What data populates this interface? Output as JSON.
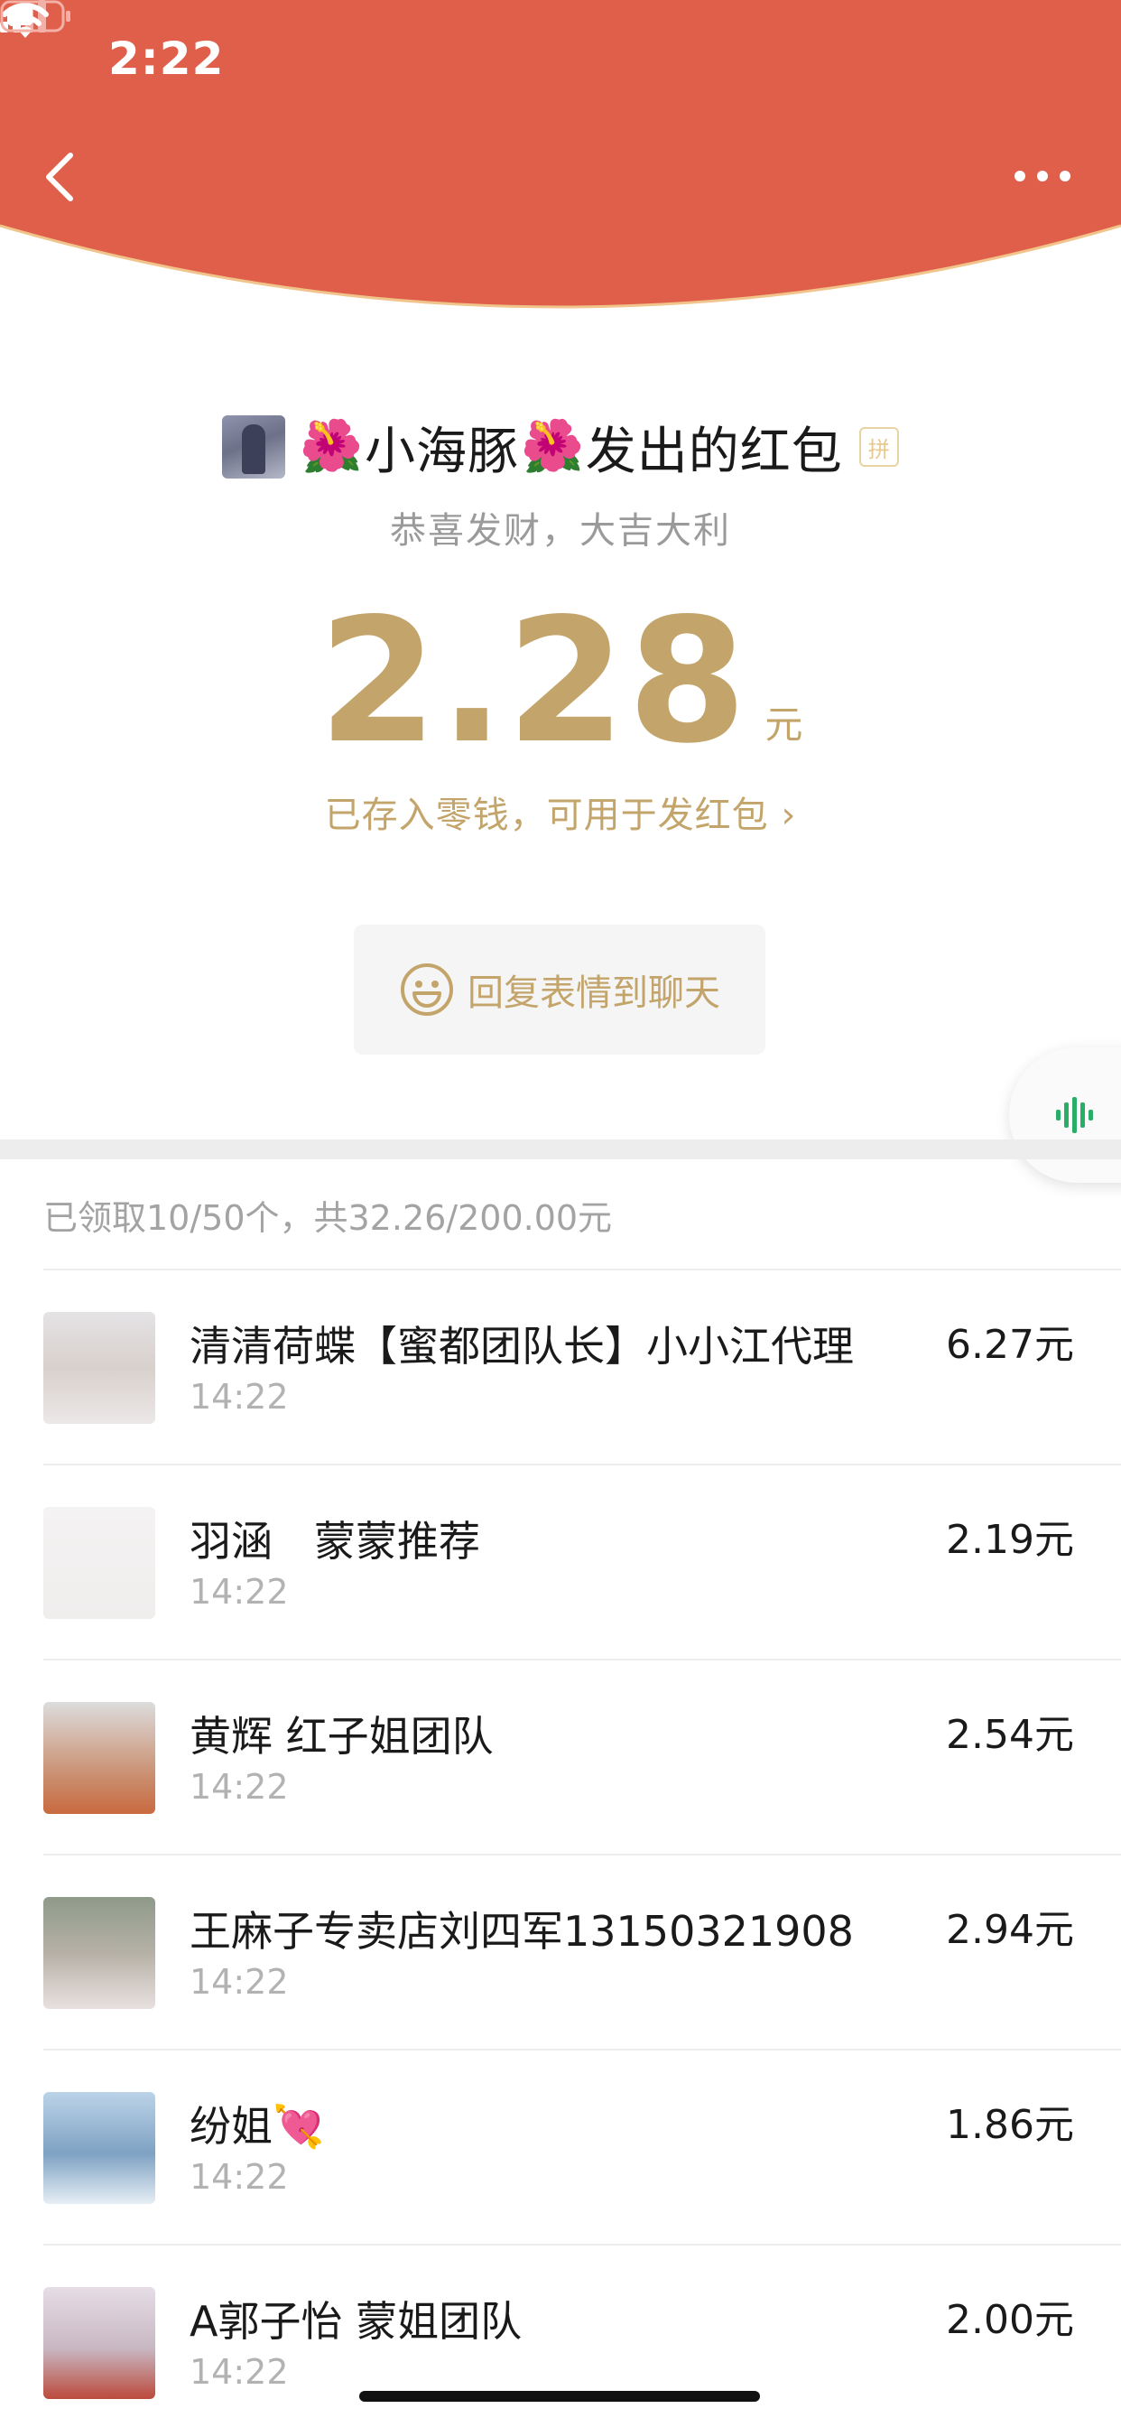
{
  "status_bar": {
    "time": "2:22"
  },
  "header": {
    "color": "#e05f4b",
    "icons": [
      "back-arrow-icon",
      "more-dots-icon"
    ]
  },
  "packet": {
    "sender_title": "小海豚",
    "sender_suffix": "发出的红包",
    "flower_emoji": "🌺",
    "pin_badge": "拼",
    "greeting": "恭喜发财，大吉大利",
    "amount": "2.28",
    "unit": "元",
    "saved_note": "已存入零钱，可用于发红包 ›",
    "reply_label": "回复表情到聊天"
  },
  "summary": "已领取10/50个，共32.26/200.00元",
  "receivers": [
    {
      "name": "清清荷蝶【蜜都团队长】小小江代理",
      "time": "14:22",
      "amount": "6.27元"
    },
    {
      "name": "羽涵　蒙蒙推荐",
      "time": "14:22",
      "amount": "2.19元"
    },
    {
      "name": "黄辉 红子姐团队",
      "time": "14:22",
      "amount": "2.54元"
    },
    {
      "name": "王麻子专卖店刘四军13150321908",
      "time": "14:22",
      "amount": "2.94元"
    },
    {
      "name": "纷姐💘",
      "time": "14:22",
      "amount": "1.86元"
    },
    {
      "name": "A郭子怡 蒙姐团队",
      "time": "14:22",
      "amount": "2.00元"
    }
  ],
  "colors": {
    "gold": "#c3a56c",
    "accent_green": "#2aae67"
  }
}
